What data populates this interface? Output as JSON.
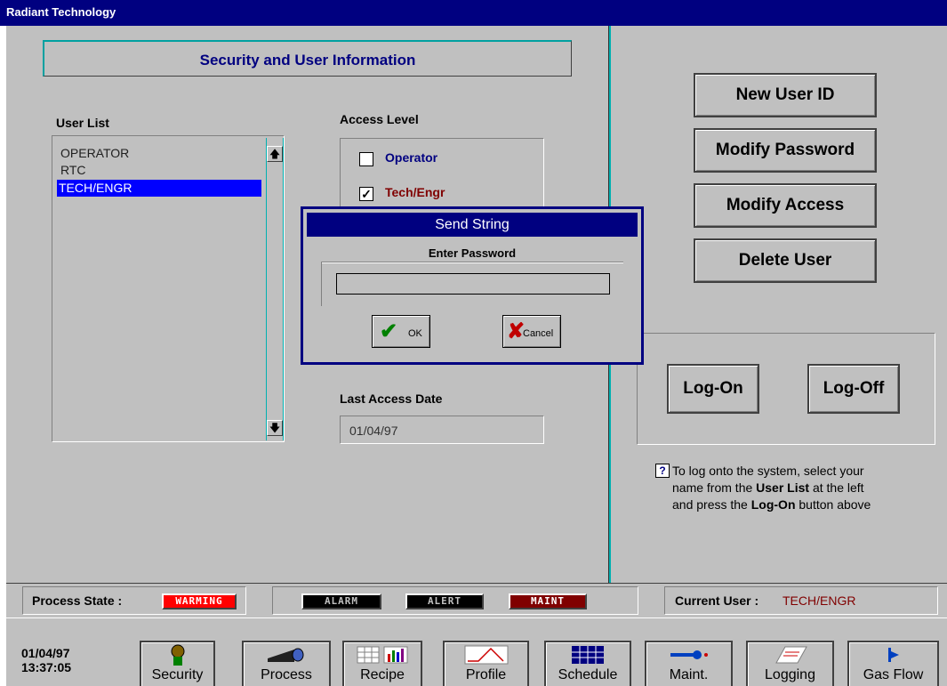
{
  "window": {
    "title": "Radiant Technology"
  },
  "header": {
    "title": "Security and User Information"
  },
  "user_list": {
    "label": "User List",
    "items": [
      {
        "label": "OPERATOR",
        "selected": false
      },
      {
        "label": "RTC",
        "selected": false
      },
      {
        "label": "TECH/ENGR",
        "selected": true
      }
    ],
    "scroll_up_icon": "up-arrow",
    "scroll_down_icon": "down-arrow"
  },
  "access": {
    "label": "Access Level",
    "levels": [
      {
        "label": "Operator",
        "checked": false,
        "color": "#000080"
      },
      {
        "label": "Tech/Engr",
        "checked": true,
        "color": "#800000"
      }
    ]
  },
  "last_access": {
    "label": "Last Access Date",
    "value": "01/04/97"
  },
  "actions": {
    "new_user": "New User ID",
    "modify_password": "Modify Password",
    "modify_access": "Modify Access",
    "delete_user": "Delete User",
    "log_on": "Log-On",
    "log_off": "Log-Off"
  },
  "help": {
    "line1": "To log onto the system, select your",
    "line2_a": "name from the ",
    "line2_b": "User List",
    "line2_c": "  at the left",
    "line3_a": "and press the ",
    "line3_b": "Log-On",
    "line3_c": " button above"
  },
  "dialog": {
    "title": "Send String",
    "prompt": "Enter Password",
    "input_value": "",
    "ok_label": "OK",
    "cancel_label": "Cancel"
  },
  "status": {
    "process_label": "Process State :",
    "process_value": "WARMING",
    "alarm": "ALARM",
    "alert": "ALERT",
    "maint": "MAINT",
    "user_label": "Current User :",
    "user_value": "TECH/ENGR",
    "colors": {
      "warming": "#ff0000",
      "maint": "#800000",
      "user": "#800000"
    }
  },
  "clock": {
    "date": "01/04/97",
    "time": "13:37:05"
  },
  "nav": [
    {
      "label": "Security",
      "icon": "person-icon"
    },
    {
      "label": "Process",
      "icon": "oven-icon"
    },
    {
      "label": "Recipe",
      "icon": "table-chart-icon"
    },
    {
      "label": "Profile",
      "icon": "profile-graph-icon"
    },
    {
      "label": "Schedule",
      "icon": "grid-icon"
    },
    {
      "label": "Maint.",
      "icon": "wrench-icon"
    },
    {
      "label": "Logging",
      "icon": "notepad-icon"
    },
    {
      "label": "Gas Flow",
      "icon": "valve-icon"
    }
  ]
}
